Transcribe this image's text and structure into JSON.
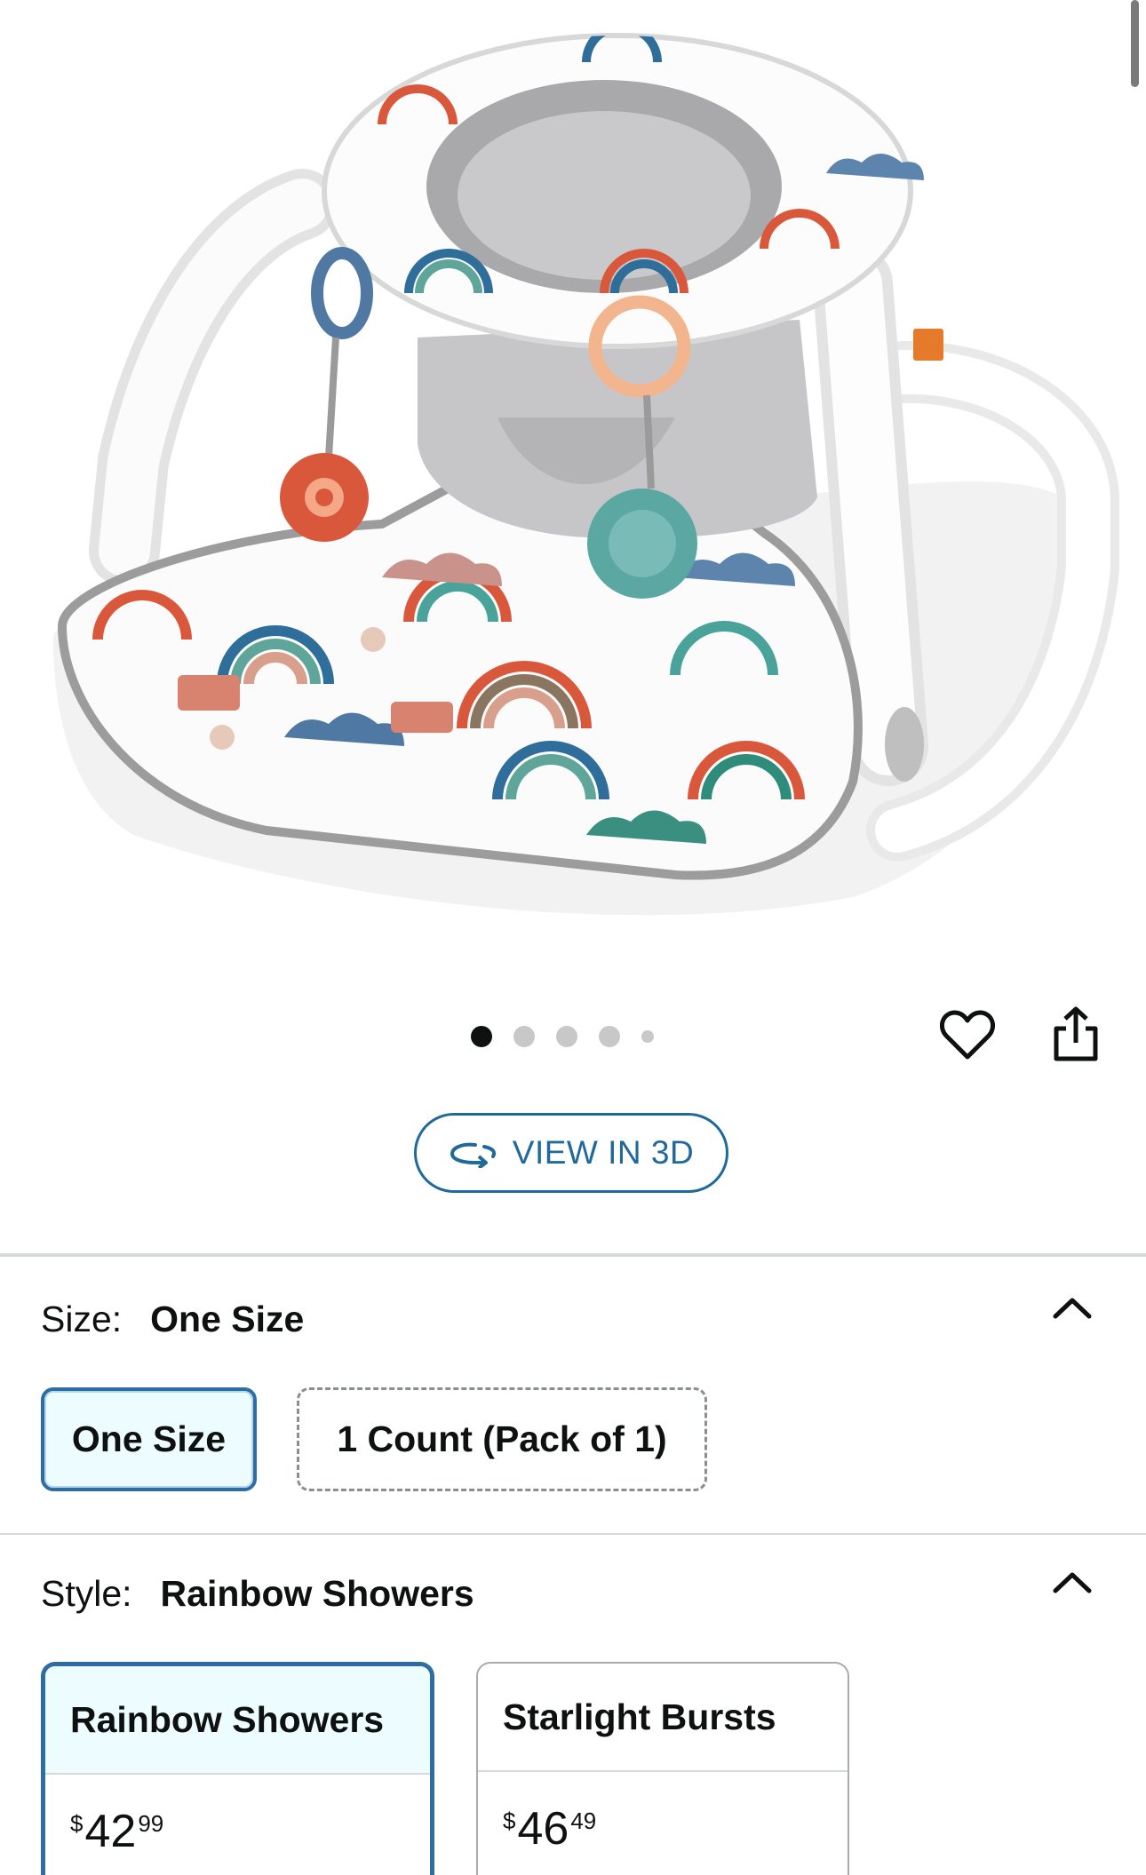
{
  "product": {
    "image_alt": "Rainbow floor seat with toys",
    "carousel": {
      "total": 5,
      "active_index": 0
    }
  },
  "actions": {
    "favorite_icon": "heart-outline-icon",
    "share_icon": "share-icon",
    "view_3d_label": "VIEW IN 3D",
    "view_3d_icon": "rotate-3d-icon"
  },
  "size": {
    "label": "Size:",
    "selected": "One Size",
    "options": [
      "One Size",
      "1 Count (Pack of 1)"
    ]
  },
  "style": {
    "label": "Style:",
    "selected": "Rainbow Showers",
    "options": [
      {
        "name": "Rainbow Showers",
        "currency": "$",
        "price_whole": "42",
        "price_cents": "99"
      },
      {
        "name": "Starlight Bursts",
        "currency": "$",
        "price_whole": "46",
        "price_cents": "49"
      }
    ]
  },
  "colors": {
    "accent": "#2d6da3",
    "link": "#1f6a9a",
    "selected_bg": "#edfdff"
  }
}
